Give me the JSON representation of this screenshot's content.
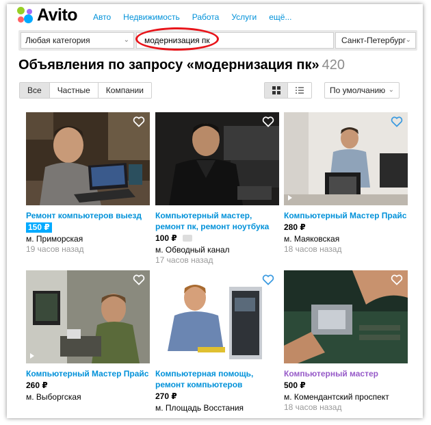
{
  "brand": {
    "name": "Avito"
  },
  "nav": [
    "Авто",
    "Недвижимость",
    "Работа",
    "Услуги",
    "ещё..."
  ],
  "search": {
    "category": "Любая категория",
    "query": "модернизация пк",
    "city": "Санкт-Петербург"
  },
  "results": {
    "title": "Объявления по запросу «модернизация пк»",
    "count": "420"
  },
  "filters": {
    "seller_types": [
      "Все",
      "Частные",
      "Компании"
    ],
    "active_seller_type": "Все",
    "view_mode": "grid",
    "sort": "По умолчанию"
  },
  "listings": [
    {
      "title": "Ремонт компьютеров выезд",
      "price": "150 ₽",
      "price_promo": true,
      "location": "м. Приморская",
      "time": "19 часов назад",
      "video": false
    },
    {
      "title": "Компьютерный мастер, ремонт пк, ремонт ноутбука",
      "price": "100 ₽",
      "location": "м. Обводный канал",
      "time": "17 часов назад",
      "video": false
    },
    {
      "title": "Компьютерный Мастер Прайс",
      "price": "280 ₽",
      "location": "м. Маяковская",
      "time": "18 часов назад",
      "video": true
    },
    {
      "title": "Компьютерный Мастер Прайс",
      "price": "260 ₽",
      "location": "м. Выборгская",
      "time": "",
      "video": true
    },
    {
      "title": "Компьютерная помощь, ремонт компьютеров",
      "price": "270 ₽",
      "location": "м. Площадь Восстания",
      "time": "",
      "video": false
    },
    {
      "title": "Компьютерный мастер",
      "price": "500 ₽",
      "location": "м. Комендантский проспект",
      "time": "18 часов назад",
      "video": false,
      "visited": true
    }
  ],
  "colors": {
    "link": "#0091d9",
    "visited": "#965ac8",
    "promo": "#00aaff",
    "highlight": "#e8141a"
  }
}
